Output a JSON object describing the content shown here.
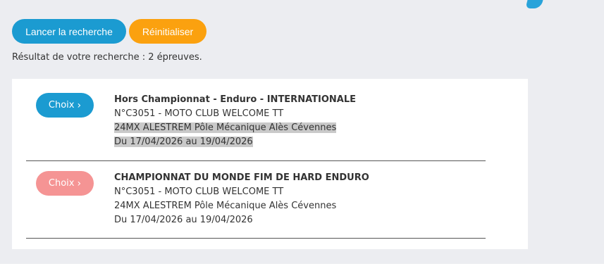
{
  "actions": {
    "search_label": "Lancer la recherche",
    "reset_label": "Réinitialiser"
  },
  "summary": "Résultat de votre recherche : 2 épreuves.",
  "events": [
    {
      "choice_label": "Choix",
      "title": "Hors Championnat - Enduro - INTERNATIONALE",
      "club": "N°C3051 - MOTO CLUB WELCOME TT",
      "venue": "24MX ALESTREM Pôle Mécanique Alès Cévennes",
      "dates": "Du 17/04/2026 au 19/04/2026",
      "button_color": "#1b9bd1",
      "selected_text": true
    },
    {
      "choice_label": "Choix",
      "title": "CHAMPIONNAT DU MONDE FIM DE HARD ENDURO",
      "club": "N°C3051 - MOTO CLUB WELCOME TT",
      "venue": "24MX ALESTREM Pôle Mécanique Alès Cévennes",
      "dates": "Du 17/04/2026 au 19/04/2026",
      "button_color": "#f59494",
      "selected_text": false
    }
  ],
  "icons": {
    "choice_chevron": "chevron-right-icon",
    "corner": "blue-logo-fragment"
  },
  "colors": {
    "primary": "#1b9bd1",
    "secondary": "#fba10f",
    "disabled_choice": "#f59494",
    "background": "#ecedf1"
  }
}
